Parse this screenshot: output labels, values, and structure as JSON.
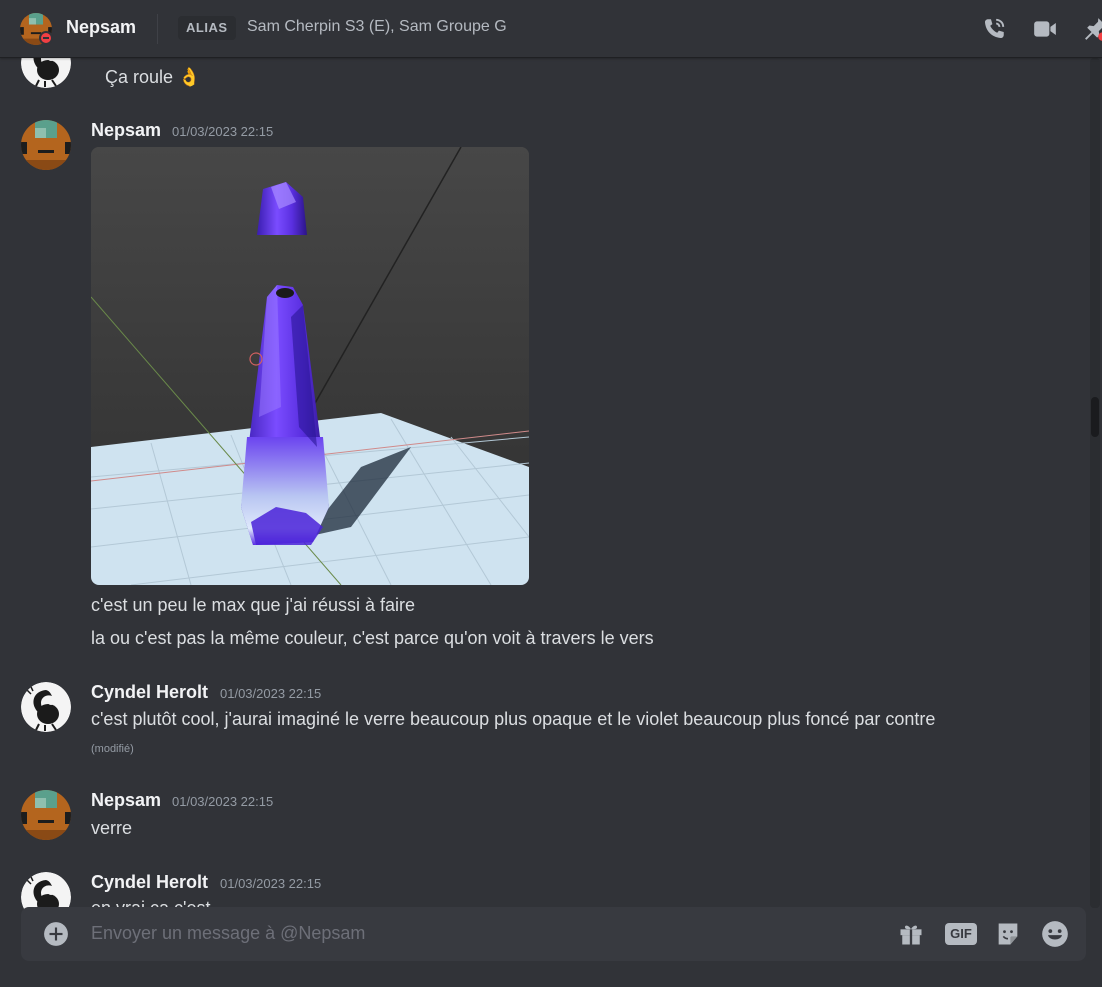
{
  "header": {
    "name": "Nepsam",
    "alias_label": "ALIAS",
    "alias_names": "Sam Cherpin S3 (E), Sam Groupe G",
    "icons": [
      "phone-call-icon",
      "video-camera-icon",
      "pin-icon"
    ]
  },
  "messages": [
    {
      "author": "",
      "timestamp": "",
      "lines": [
        "Ça roule 👌"
      ]
    },
    {
      "author": "Nepsam",
      "timestamp": "01/03/2023 22:15",
      "attachment": "image",
      "lines": [
        "c'est un peu le max que j'ai réussi à faire",
        "la ou c'est pas la même couleur, c'est parce qu'on voit à travers le vers"
      ]
    },
    {
      "author": "Cyndel Herolt",
      "timestamp": "01/03/2023 22:15",
      "lines": [
        "c'est plutôt cool, j'aurai imaginé le verre beaucoup plus opaque et le violet beaucoup plus foncé par contre"
      ],
      "edited": "(modifié)"
    },
    {
      "author": "Nepsam",
      "timestamp": "01/03/2023 22:15",
      "lines": [
        "verre"
      ]
    },
    {
      "author": "Cyndel Herolt",
      "timestamp": "01/03/2023 22:15",
      "lines": [
        "en vrai ça c'est"
      ]
    }
  ],
  "composer": {
    "placeholder": "Envoyer un message à @Nepsam",
    "gif_label": "GIF",
    "icons": [
      "add-attachment-icon",
      "gift-icon",
      "gif-icon",
      "sticker-icon",
      "emoji-icon"
    ]
  },
  "colors": {
    "background": "#313338",
    "composer": "#383a40",
    "muted": "#949ba4",
    "dnd": "#f23f43"
  }
}
